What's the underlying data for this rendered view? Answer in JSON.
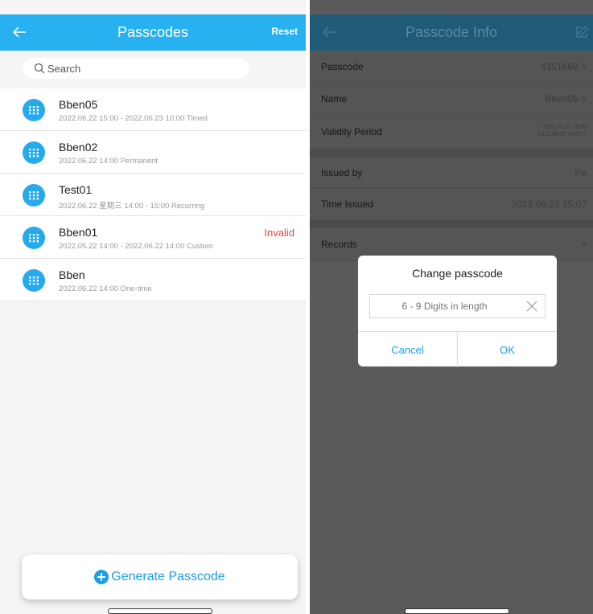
{
  "left": {
    "header": {
      "title": "Passcodes",
      "reset_label": "Reset"
    },
    "search": {
      "placeholder": "Search"
    },
    "passcodes": [
      {
        "name": "Bben05",
        "meta": "2022.06.22 15:00 - 2022.06.23 10:00   Timed",
        "flag": ""
      },
      {
        "name": "Bben02",
        "meta": "2022.06.22 14:00   Permanent",
        "flag": ""
      },
      {
        "name": "Test01",
        "meta": "2022.06.22   星期三 14:00 - 15:00   Recurring",
        "flag": ""
      },
      {
        "name": "Bben01",
        "meta": "2022.05.22 14:00 - 2022.06.22 14:00   Custom",
        "flag": "Invalid"
      },
      {
        "name": "Bben",
        "meta": "2022.06.22 14:00   One-time",
        "flag": ""
      }
    ],
    "generate_label": "Generate Passcode"
  },
  "right": {
    "header": {
      "title": "Passcode Info"
    },
    "rows": {
      "passcode": {
        "label": "Passcode",
        "value": "4351668 >"
      },
      "name": {
        "label": "Name",
        "value": "Bben05 >"
      },
      "validity": {
        "label": "Validity Period",
        "start": "2022.06.22 15:00",
        "end": "2022.06.23 10:00 >"
      },
      "issued_by": {
        "label": "Issued by",
        "value": "Pe"
      },
      "time_issued": {
        "label": "Time Issued",
        "value": "2022.06.22 15:07"
      },
      "records": {
        "label": "Records",
        "value": ">"
      }
    },
    "dialog": {
      "title": "Change passcode",
      "input_placeholder": "6 - 9 Digits in length",
      "cancel_label": "Cancel",
      "ok_label": "OK"
    }
  },
  "colors": {
    "primary": "#27b1f0",
    "accent": "#1c9ee6",
    "invalid": "#e84242"
  }
}
